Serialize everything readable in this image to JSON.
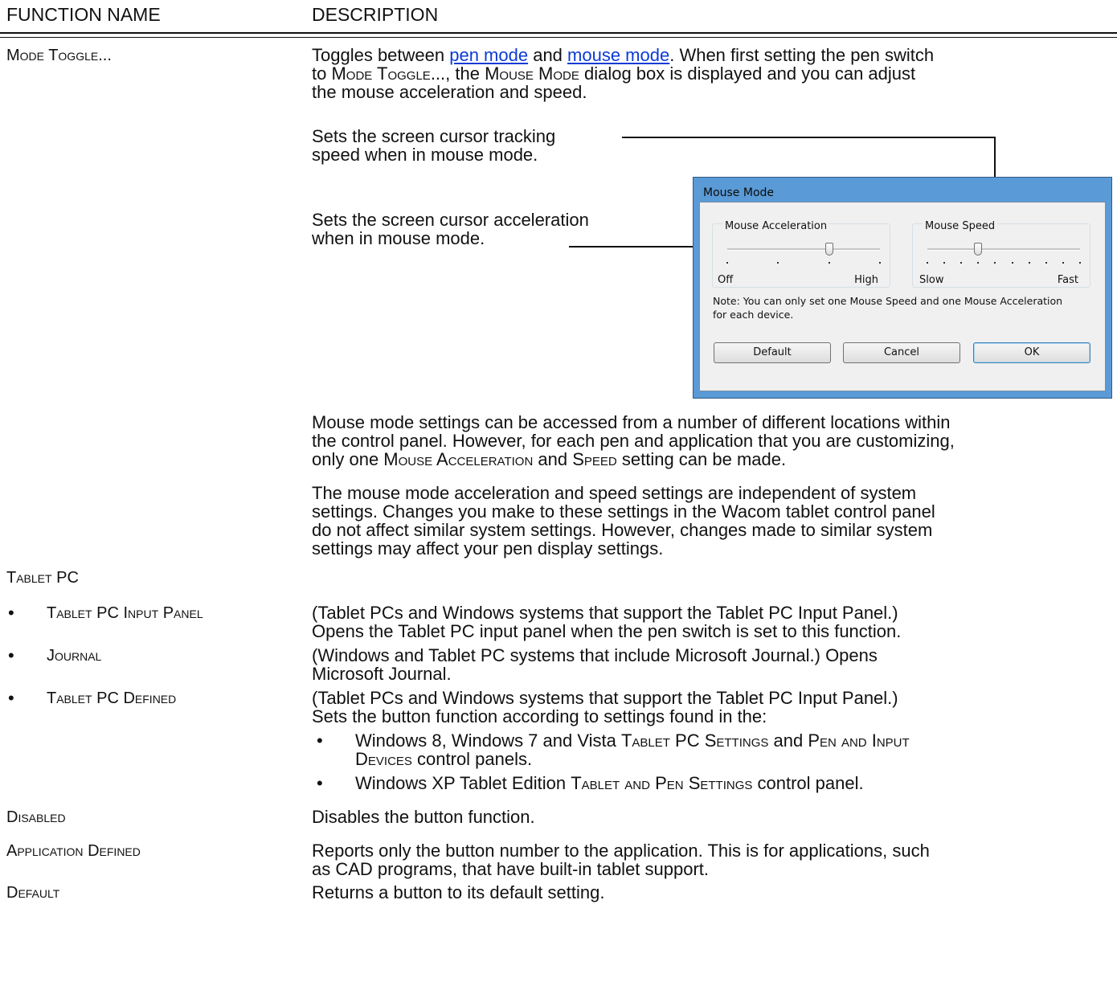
{
  "header": {
    "col1": "FUNCTION NAME",
    "col2": "DESCRIPTION"
  },
  "mode_toggle": {
    "name": "Mode Toggle...",
    "desc_part1": "Toggles between ",
    "link1": "pen mode",
    "desc_part2": " and ",
    "link2": "mouse mode",
    "desc_part3": ".  When first setting the pen switch",
    "line2_a": "to ",
    "line2_sc1": "Mode Toggle",
    "line2_b": "..., the ",
    "line2_sc2": "Mouse Mode",
    "line2_c": " dialog box is displayed and you can adjust",
    "line3": "the mouse acceleration and speed.",
    "callout_speed": [
      "Sets the screen cursor tracking",
      "speed when in mouse mode."
    ],
    "callout_accel": [
      "Sets the screen cursor acceleration",
      "when in mouse mode."
    ],
    "para1": [
      "Mouse mode settings can be accessed from a number of different locations within",
      "the control panel.  However, for each pen and application that you are customizing,"
    ],
    "para1_l3_a": "only one ",
    "para1_l3_sc1": "Mouse Acceleration",
    "para1_l3_b": " and ",
    "para1_l3_sc2": "Speed",
    "para1_l3_c": " setting can be made.",
    "para2": [
      "The mouse mode acceleration and speed settings are independent of system",
      "settings.  Changes you make to these settings in the Wacom tablet control panel",
      "do not affect similar system settings.  However, changes made to similar system",
      "settings may affect your pen display settings."
    ]
  },
  "dialog": {
    "title": "Mouse Mode",
    "accel_label": "Mouse Acceleration",
    "accel_low": "Off",
    "accel_high": "High",
    "accel_value": 3,
    "accel_steps": 4,
    "speed_label": "Mouse Speed",
    "speed_low": "Slow",
    "speed_high": "Fast",
    "speed_value": 4,
    "speed_steps": 10,
    "note": [
      "Note: You can only set one Mouse Speed and one Mouse Acceleration",
      "for each device."
    ],
    "btn_default": "Default",
    "btn_cancel": "Cancel",
    "btn_ok": "OK"
  },
  "tablet_pc": {
    "heading": "Tablet PC",
    "bullet": "•",
    "items": [
      {
        "name": "Tablet PC Input Panel",
        "desc": [
          "(Tablet PCs and Windows systems that support the Tablet PC Input Panel.)",
          "Opens the Tablet PC input panel when the pen switch is set to this function."
        ]
      },
      {
        "name": "Journal",
        "desc": [
          "(Windows and Tablet PC systems that include Microsoft Journal.)  Opens",
          "Microsoft Journal."
        ]
      },
      {
        "name": "Tablet PC Defined",
        "desc": [
          "(Tablet PCs and Windows systems that support the Tablet PC Input Panel.)",
          "Sets the button function according to settings found in the:"
        ]
      }
    ],
    "sub1_a": "Windows 8, Windows 7 and Vista ",
    "sub1_sc1": "Tablet PC Settings",
    "sub1_b": " and ",
    "sub1_sc2": "Pen and Input",
    "sub1_l2_sc": "Devices",
    "sub1_l2_b": " control panels.",
    "sub2_a": "Windows XP Tablet Edition ",
    "sub2_sc": "Tablet and Pen Settings",
    "sub2_b": " control panel."
  },
  "rows": [
    {
      "name": "Disabled",
      "desc": [
        "Disables the button function."
      ]
    },
    {
      "name": "Application Defined",
      "desc": [
        "Reports only the button number to the application.  This is for applications, such",
        "as CAD programs, that have built-in tablet support."
      ]
    },
    {
      "name": "Default",
      "desc": [
        "Returns a button to its default setting."
      ]
    }
  ]
}
